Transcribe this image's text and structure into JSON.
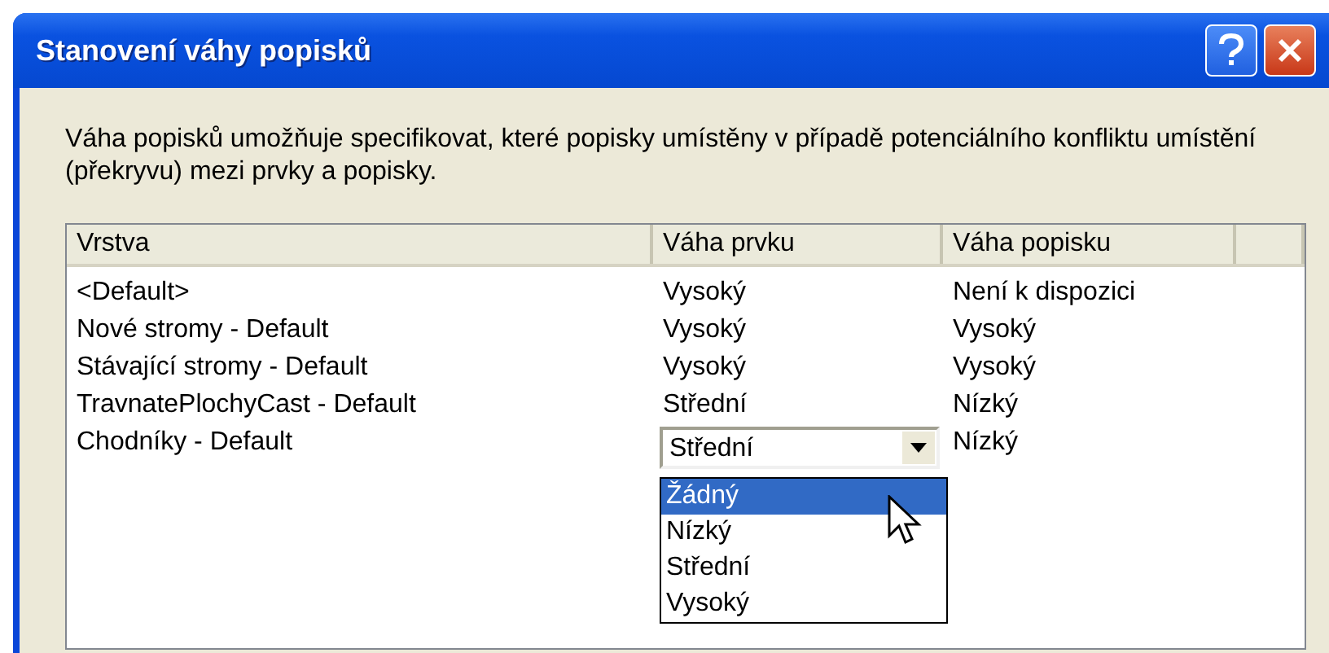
{
  "window": {
    "title": "Stanovení váhy popisků"
  },
  "description": "Váha popisků umožňuje specifikovat, které popisky umístěny v případě potenciálního konfliktu umístění (překryvu) mezi prvky a popisky.",
  "table": {
    "columns": [
      "Vrstva",
      "Váha prvku",
      "Váha popisku"
    ],
    "rows": [
      {
        "kind": "text",
        "layer": "<Default>",
        "feature_weight": "Vysoký",
        "label_weight": "Není k dispozici"
      },
      {
        "kind": "text",
        "layer": "Nové stromy - Default",
        "feature_weight": "Vysoký",
        "label_weight": "Vysoký"
      },
      {
        "kind": "text",
        "layer": "Stávající stromy - Default",
        "feature_weight": "Vysoký",
        "label_weight": "Vysoký"
      },
      {
        "kind": "text",
        "layer": "TravnatePlochyCast - Default",
        "feature_weight": "Střední",
        "label_weight": "Nízký"
      },
      {
        "kind": "combo",
        "layer": "Chodníky - Default",
        "feature_weight": "Střední",
        "label_weight": "Nízký"
      }
    ]
  },
  "dropdown": {
    "options": [
      {
        "label": "Žádný",
        "selected": true
      },
      {
        "label": "Nízký",
        "selected": false
      },
      {
        "label": "Střední",
        "selected": false
      },
      {
        "label": "Vysoký",
        "selected": false
      }
    ]
  }
}
